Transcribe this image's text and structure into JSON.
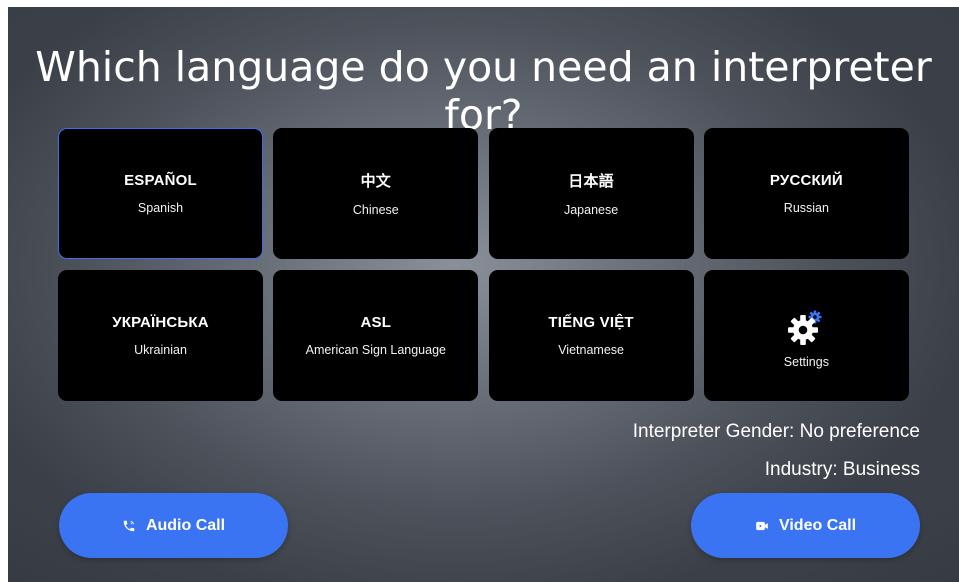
{
  "title": "Which language do you need an interpreter for?",
  "languages": [
    {
      "native": "ESPAÑOL",
      "english": "Spanish",
      "selected": true
    },
    {
      "native": "中文",
      "english": "Chinese",
      "selected": false
    },
    {
      "native": "日本語",
      "english": "Japanese",
      "selected": false
    },
    {
      "native": "РУССКИЙ",
      "english": "Russian",
      "selected": false
    },
    {
      "native": "УКРАЇНСЬКА",
      "english": "Ukrainian",
      "selected": false
    },
    {
      "native": "ASL",
      "english": "American Sign Language",
      "selected": false
    },
    {
      "native": "TIẾNG VIỆT",
      "english": "Vietnamese",
      "selected": false
    }
  ],
  "settings_tile": {
    "label": "Settings",
    "icon": "gear-icon"
  },
  "info": {
    "gender": "Interpreter Gender: No preference",
    "industry": "Industry: Business"
  },
  "buttons": {
    "audio_call": {
      "label": "Audio Call",
      "icon": "phone-icon"
    },
    "video_call": {
      "label": "Video Call",
      "icon": "video-camera-icon"
    }
  },
  "colors": {
    "accent": "#3a74f2",
    "selected_border": "#3b6ef0",
    "tile_bg": "#000000"
  }
}
